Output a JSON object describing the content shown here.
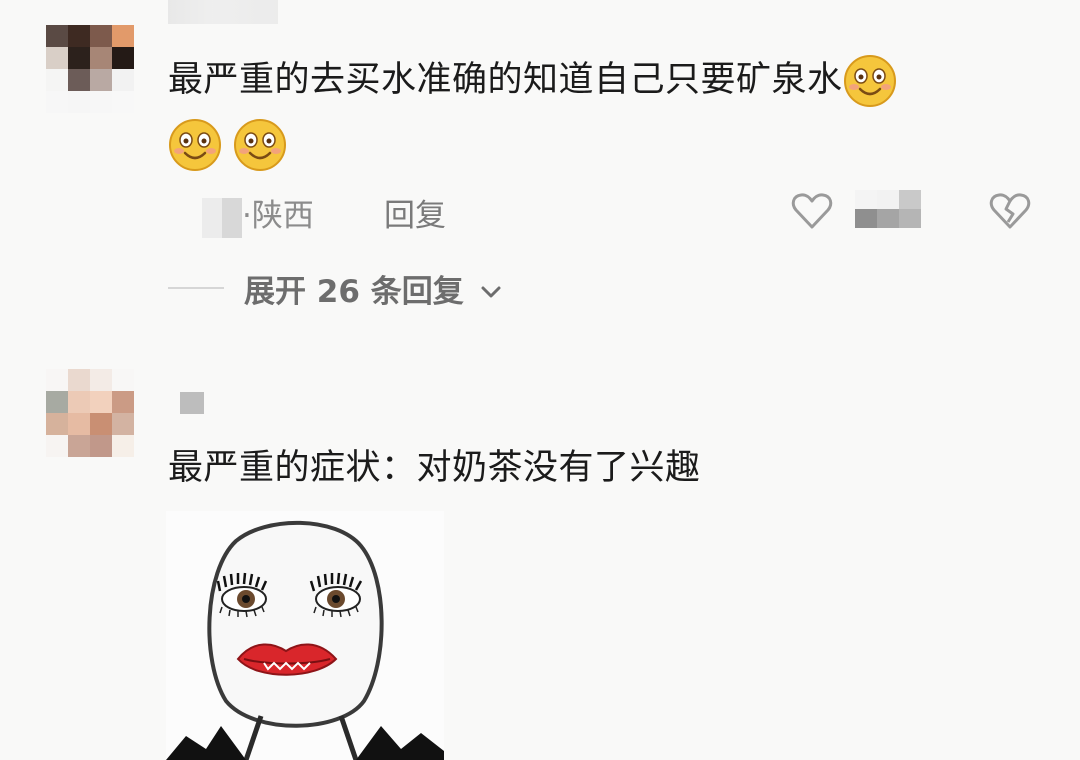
{
  "comments": [
    {
      "text": "最严重的去买水准确的知道自己只要矿泉水",
      "emojis": [
        "smile-emoji",
        "smile-emoji",
        "smile-emoji"
      ],
      "location": "·陕西",
      "reply_label": "回复",
      "expand_label": "展开 26 条回复"
    },
    {
      "text": "最严重的症状：对奶茶没有了兴趣"
    }
  ],
  "icons": {
    "like": "heart-outline-icon",
    "dislike": "broken-heart-icon",
    "expand": "chevron-down-icon"
  },
  "colors": {
    "background": "#f9f9f8",
    "text": "#1b1b1b",
    "meta": "#8c8c8c",
    "lipstick": "#d9262b"
  }
}
